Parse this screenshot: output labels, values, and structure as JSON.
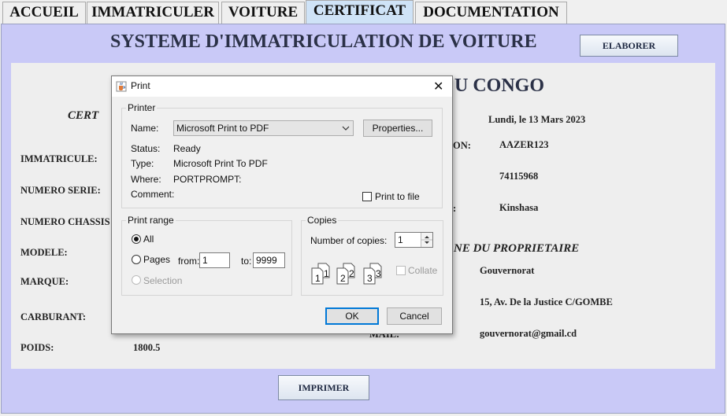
{
  "tabs": [
    "ACCUEIL",
    "IMMATRICULER",
    "VOITURE",
    "CERTIFICAT",
    "DOCUMENTATION"
  ],
  "active_tab": "CERTIFICAT",
  "header": {
    "title": "SYSTEME D'IMMATRICULATION DE VOITURE",
    "elaborer_label": "ELABORER"
  },
  "certificate": {
    "heading_right": "U CONGO",
    "subheading_left": "CERT",
    "date": "Lundi, le 13 Mars 2023",
    "left_fields": [
      {
        "label": "IMMATRICULE:",
        "value": ""
      },
      {
        "label": "NUMERO SERIE:",
        "value": ""
      },
      {
        "label": "NUMERO CHASSIS",
        "value": ""
      },
      {
        "label": "MODELE:",
        "value": ""
      },
      {
        "label": "MARQUE:",
        "value": ""
      },
      {
        "label": "CARBURANT:",
        "value": ""
      },
      {
        "label": "POIDS:",
        "value": "1800.5"
      }
    ],
    "right_partial_label_1": "ON:",
    "right_value_1": "AAZER123",
    "right_value_2": "74115968",
    "right_partial_label_3": ":",
    "right_value_3": "Kinshasa",
    "owner_section_title": "NE DU PROPRIETAIRE",
    "owner_name": "Gouvernorat",
    "owner_address": "15, Av. De la Justice C/GOMBE",
    "mail_label": "MAIL:",
    "owner_email": "gouvernorat@gmail.cd"
  },
  "print_button_label": "IMPRIMER",
  "print_dialog": {
    "title": "Print",
    "close_glyph": "✕",
    "printer_group": "Printer",
    "name_label": "Name:",
    "printer_name": "Microsoft Print to PDF",
    "properties_label": "Properties...",
    "status_label": "Status:",
    "status_value": "Ready",
    "type_label": "Type:",
    "type_value": "Microsoft Print To PDF",
    "where_label": "Where:",
    "where_value": "PORTPROMPT:",
    "comment_label": "Comment:",
    "print_to_file_label": "Print to file",
    "print_range_group": "Print range",
    "all_label": "All",
    "pages_label": "Pages",
    "from_label": "from:",
    "from_value": "1",
    "to_label": "to:",
    "to_value": "9999",
    "selection_label": "Selection",
    "copies_group": "Copies",
    "copies_label": "Number of copies:",
    "copies_value": "1",
    "collate_label": "Collate",
    "ok_label": "OK",
    "cancel_label": "Cancel"
  }
}
